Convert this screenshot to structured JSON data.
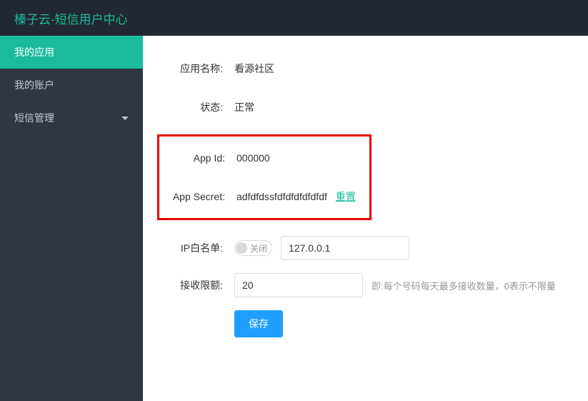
{
  "header": {
    "title": "榛子云-短信用户中心"
  },
  "sidebar": {
    "items": [
      {
        "label": "我的应用",
        "active": true,
        "hasChevron": false
      },
      {
        "label": "我的账户",
        "active": false,
        "hasChevron": false
      },
      {
        "label": "短信管理",
        "active": false,
        "hasChevron": true
      }
    ]
  },
  "form": {
    "appNameLabel": "应用名称:",
    "appNameValue": "看源社区",
    "statusLabel": "状态:",
    "statusValue": "正常",
    "appIdLabel": "App Id:",
    "appIdValue": "000000",
    "appSecretLabel": "App Secret:",
    "appSecretValue": "adfdfdssfdfdfdfdfdfdf",
    "resetLabel": "重置",
    "ipWhitelistLabel": "IP白名单:",
    "ipToggleLabel": "关闭",
    "ipValue": "127.0.0.1",
    "limitLabel": "接收限额:",
    "limitValue": "20",
    "limitHelp": "即:每个号码每天最多接收数量，0表示不限量",
    "saveLabel": "保存"
  }
}
